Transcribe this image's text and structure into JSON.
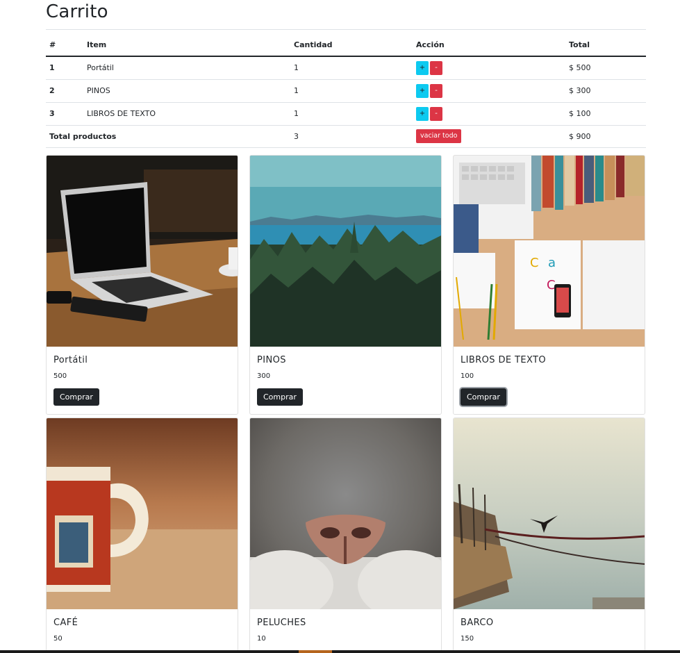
{
  "page": {
    "title": "Carrito"
  },
  "cart": {
    "headers": {
      "num": "#",
      "item": "Item",
      "qty": "Cantidad",
      "action": "Acción",
      "total": "Total"
    },
    "rows": [
      {
        "num": "1",
        "item": "Portátil",
        "qty": "1",
        "plus": "+",
        "minus": "-",
        "total": "$ 500"
      },
      {
        "num": "2",
        "item": "PINOS",
        "qty": "1",
        "plus": "+",
        "minus": "-",
        "total": "$ 300"
      },
      {
        "num": "3",
        "item": "LIBROS DE TEXTO",
        "qty": "1",
        "plus": "+",
        "minus": "-",
        "total": "$ 100"
      }
    ],
    "footer": {
      "label": "Total productos",
      "qty": "3",
      "empty_label": "vaciar todo",
      "total": "$ 900"
    }
  },
  "products": [
    {
      "title": "Portátil",
      "price": "500",
      "button": "Comprar"
    },
    {
      "title": "PINOS",
      "price": "300",
      "button": "Comprar"
    },
    {
      "title": "LIBROS DE TEXTO",
      "price": "100",
      "button": "Comprar"
    },
    {
      "title": "CAFÉ",
      "price": "50"
    },
    {
      "title": "PELUCHES",
      "price": "10"
    },
    {
      "title": "BARCO",
      "price": "150"
    }
  ],
  "colors": {
    "info": "#0dcaf0",
    "danger": "#dc3545",
    "dark": "#212529"
  }
}
